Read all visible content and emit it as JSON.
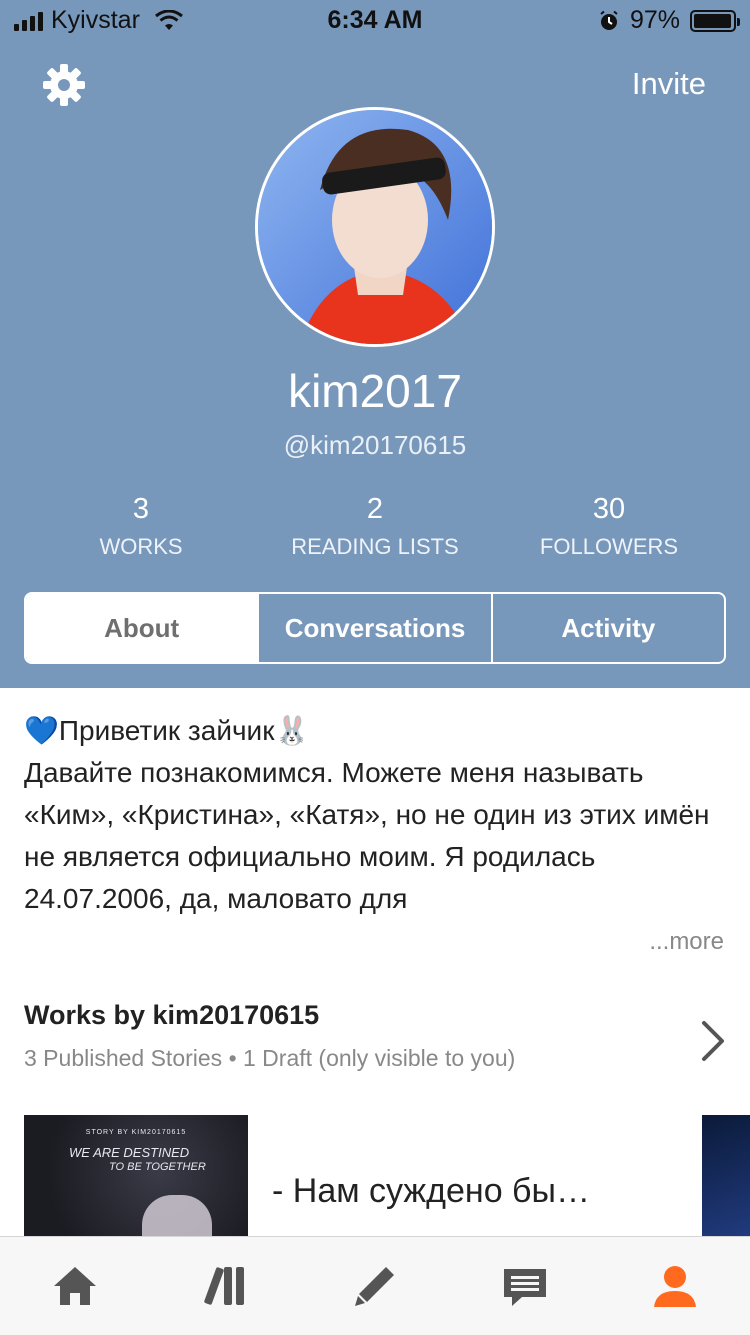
{
  "status_bar": {
    "carrier": "Kyivstar",
    "time": "6:34 AM",
    "battery": "97%",
    "battery_level": 0.97
  },
  "header": {
    "settings_icon": "gear-icon",
    "invite_label": "Invite"
  },
  "profile": {
    "display_name": "kim2017",
    "handle": "@kim20170615",
    "stats": [
      {
        "value": "3",
        "label": "WORKS"
      },
      {
        "value": "2",
        "label": "READING LISTS"
      },
      {
        "value": "30",
        "label": "FOLLOWERS"
      }
    ]
  },
  "tabs": [
    {
      "label": "About",
      "active": true
    },
    {
      "label": "Conversations",
      "active": false
    },
    {
      "label": "Activity",
      "active": false
    }
  ],
  "about": {
    "greeting": "Приветик зайчик",
    "body": "Давайте познакомимся. Можете меня называть «Ким», «Кристина», «Катя», но не один из этих имён не является официально моим. Я родилась 24.07.2006, да, маловато для",
    "more_label": "...more"
  },
  "works": {
    "title": "Works by kim20170615",
    "subtitle": "3 Published Stories • 1 Draft (only visible to you)",
    "items": [
      {
        "title": "- Нам суждено бы…",
        "cover_small_text": "STORY BY KIM20170615",
        "cover_line1": "WE ARE DESTINED",
        "cover_line2": "TO BE TOGETHER"
      }
    ]
  },
  "tab_bar": [
    {
      "icon": "home-icon"
    },
    {
      "icon": "library-icon"
    },
    {
      "icon": "write-icon"
    },
    {
      "icon": "messages-icon"
    },
    {
      "icon": "profile-icon",
      "active": true
    }
  ],
  "colors": {
    "header_bg": "#7898bb",
    "active_tab_icon": "#ff6a1f",
    "tab_icon": "#555555"
  }
}
